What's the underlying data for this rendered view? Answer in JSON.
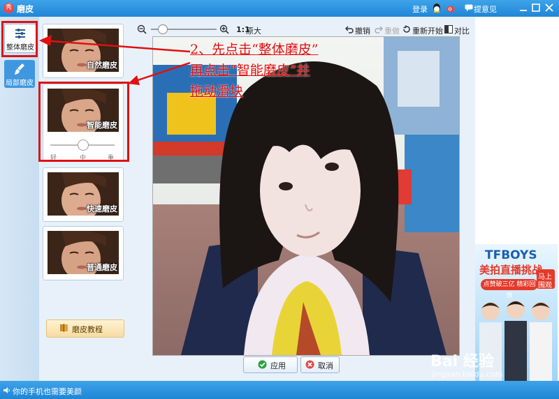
{
  "window": {
    "logo_char": "秀",
    "title": "磨皮",
    "login": "登录",
    "feedback": "提意见"
  },
  "sidebar": {
    "items": [
      {
        "label": "整体磨皮"
      },
      {
        "label": "局部磨皮"
      }
    ]
  },
  "effects": {
    "items": [
      {
        "label": "自然磨皮"
      },
      {
        "label": "智能磨皮"
      },
      {
        "label": "快速磨皮"
      },
      {
        "label": "普通磨皮"
      }
    ],
    "strength": {
      "light": "轻",
      "medium": "中",
      "heavy": "重",
      "value": "中"
    },
    "tutorial_label": "磨皮教程"
  },
  "toolbar": {
    "zoom_level_label": "1:1",
    "original_label": "原大",
    "undo": "撤销",
    "redo": "重做",
    "restart": "重新开始",
    "compare": "对比"
  },
  "actions": {
    "apply": "应用",
    "cancel": "取消"
  },
  "annotation": {
    "line1": "2、先点击“整体磨皮”",
    "line2": "再点击“智能磨皮”并",
    "line3": "拖动滑块"
  },
  "ad": {
    "brand": "TFBOYS",
    "headline": "美拍直播挑战",
    "badge_top": "马上",
    "badge_bottom": "围观",
    "subline": "点赞破三亿 精彩回放"
  },
  "status": {
    "text": "你的手机也需要美颜"
  },
  "watermark": {
    "brand": "Bai 经验",
    "url": "jingyan.baidu.com"
  },
  "colors": {
    "accent": "#1f86d6",
    "annotation": "#e01010"
  }
}
